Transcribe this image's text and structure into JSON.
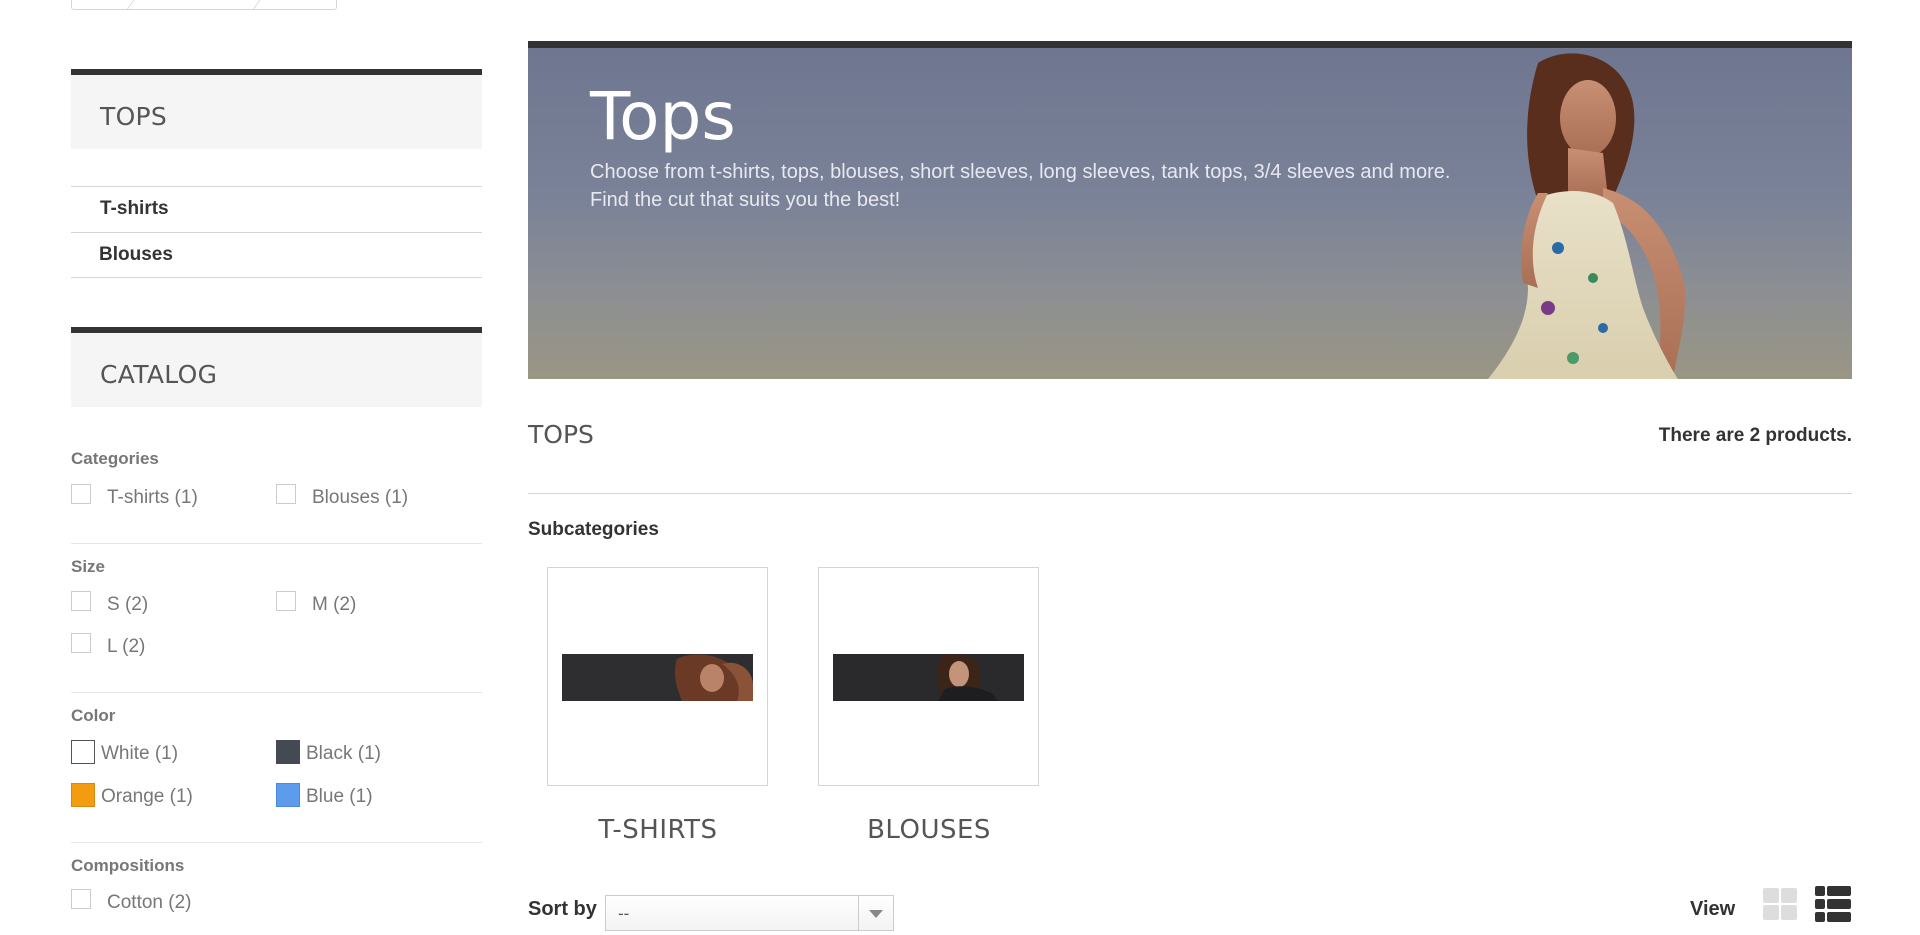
{
  "sidebar": {
    "category_block": {
      "title": "TOPS",
      "items": [
        {
          "label": "T-shirts"
        },
        {
          "label": "Blouses"
        }
      ]
    },
    "catalog_block": {
      "title": "CATALOG",
      "filters": {
        "categories": {
          "label": "Categories",
          "options": [
            {
              "label": "T-shirts (1)"
            },
            {
              "label": "Blouses (1)"
            }
          ]
        },
        "size": {
          "label": "Size",
          "options": [
            {
              "label": "S (2)"
            },
            {
              "label": "M (2)"
            },
            {
              "label": "L (2)"
            }
          ]
        },
        "color": {
          "label": "Color",
          "options": [
            {
              "label": "White (1)",
              "swatch": "#ffffff"
            },
            {
              "label": "Black (1)",
              "swatch": "#434a54"
            },
            {
              "label": "Orange (1)",
              "swatch": "#f39c11"
            },
            {
              "label": "Blue (1)",
              "swatch": "#5d9cec"
            }
          ]
        },
        "compositions": {
          "label": "Compositions",
          "options": [
            {
              "label": "Cotton (2)"
            }
          ]
        }
      }
    }
  },
  "banner": {
    "title": "Tops",
    "description_line1": "Choose from t-shirts, tops, blouses, short sleeves, long sleeves, tank tops, 3/4 sleeves and more.",
    "description_line2": "Find the cut that suits you the best!"
  },
  "main": {
    "heading": "TOPS",
    "product_count": "There are 2 products.",
    "subcategories_label": "Subcategories",
    "subcategories": [
      {
        "name": "T-SHIRTS"
      },
      {
        "name": "BLOUSES"
      }
    ],
    "sort": {
      "label": "Sort by",
      "value": "--"
    },
    "view": {
      "label": "View",
      "icons": [
        "grid-icon",
        "list-icon"
      ]
    }
  },
  "colors": {
    "accent_dark": "#333333",
    "block_bg": "#f5f5f5",
    "border": "#d6d4d4"
  }
}
